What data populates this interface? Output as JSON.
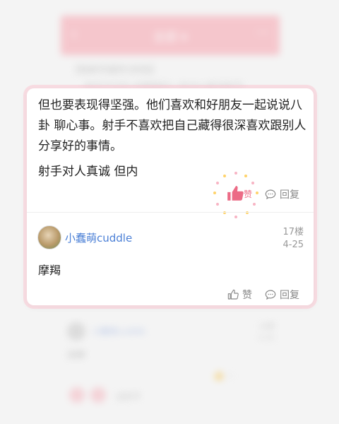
{
  "background": {
    "header": {
      "back": "‹",
      "title": "全部 ▾",
      "more": "···"
    },
    "top_line1": "【给射手座的1封信】",
    "top_line2": "射手不记仇 你睡着的一些对心脏说射手",
    "reply_name": "小蠢萌cuddle",
    "reply_floor": "18楼",
    "reply_date": "4-25",
    "reply_text": "天秤",
    "footer_text": "@射手"
  },
  "post": {
    "text_main": "但也要表现得坚强。他们喜欢和好朋友一起说说八卦  聊心事。射手不喜欢把自己藏得很深喜欢跟别人分享好的事情。",
    "text_second": "射手对人真诚 但内",
    "like_label": "赞",
    "reply_label": "回复"
  },
  "comment": {
    "username": "小蠢萌cuddle",
    "floor": "17楼",
    "date": "4-25",
    "text": "摩羯",
    "like_label": "赞",
    "reply_label": "回复"
  },
  "colors": {
    "accent": "#ec6b86",
    "link": "#4a7fd6",
    "header_bg": "#f7a2ad"
  }
}
